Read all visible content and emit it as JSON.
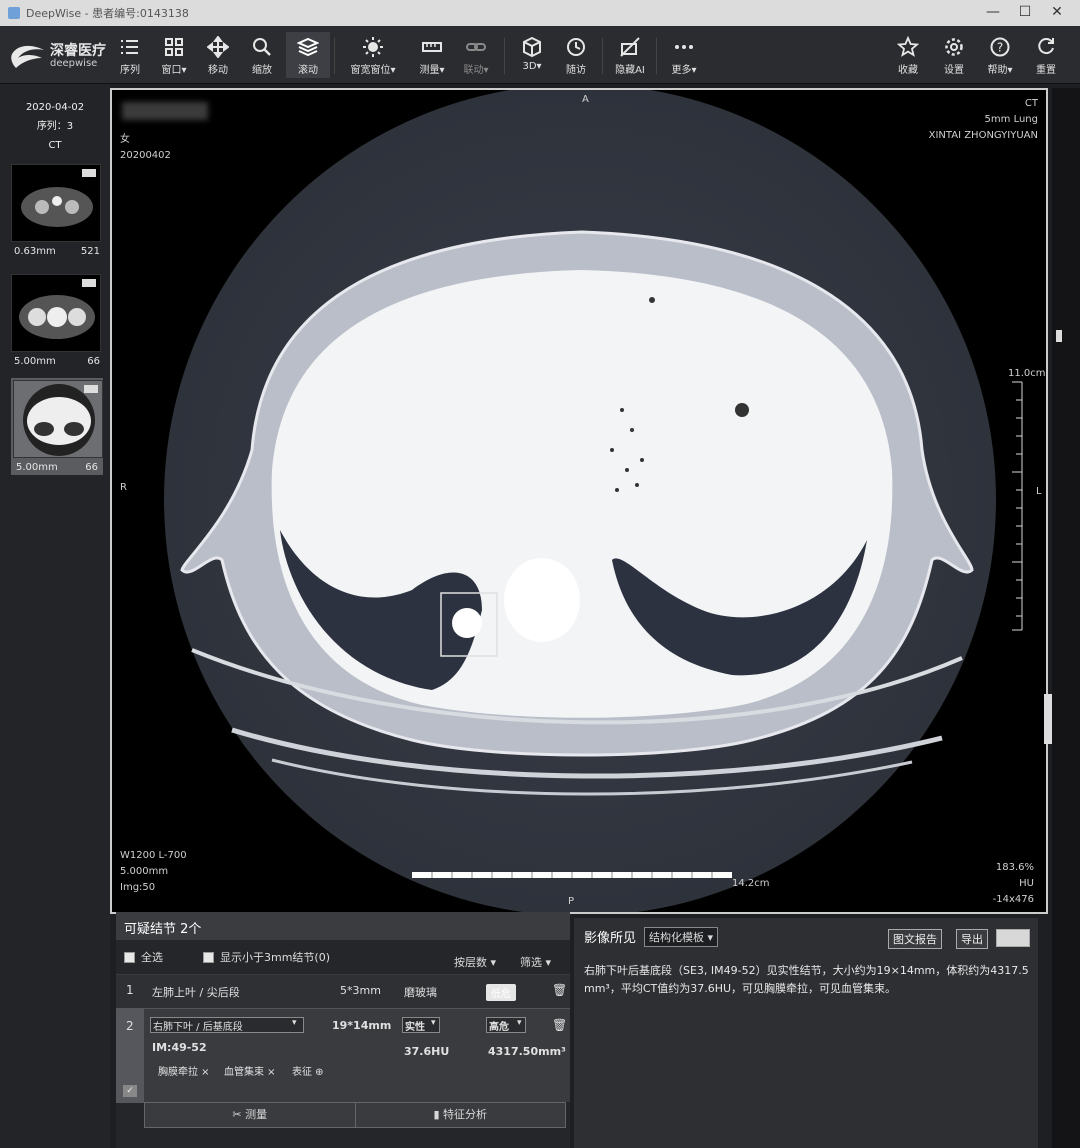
{
  "window": {
    "title": "DeepWise - 患者编号:0143138"
  },
  "logo": {
    "name": "深睿医疗",
    "sub": "deepwise"
  },
  "toolbar": [
    {
      "label": "序列",
      "icon": "list-icon"
    },
    {
      "label": "窗口▾",
      "icon": "grid-icon"
    },
    {
      "label": "移动",
      "icon": "move-icon"
    },
    {
      "label": "缩放",
      "icon": "zoom-icon"
    },
    {
      "label": "滚动",
      "icon": "layers-icon"
    },
    {
      "label": "窗宽窗位▾",
      "icon": "brightness-icon"
    },
    {
      "label": "测量▾",
      "icon": "ruler-icon"
    },
    {
      "label": "联动▾",
      "icon": "link-icon"
    },
    {
      "label": "3D▾",
      "icon": "cube-icon"
    },
    {
      "label": "随访",
      "icon": "clock-icon"
    },
    {
      "label": "隐藏AI",
      "icon": "hide-ai-icon"
    },
    {
      "label": "更多▾",
      "icon": "more-icon"
    },
    {
      "label": "收藏",
      "icon": "star-icon"
    },
    {
      "label": "设置",
      "icon": "gear-icon"
    },
    {
      "label": "帮助▾",
      "icon": "help-icon"
    },
    {
      "label": "重置",
      "icon": "reset-icon"
    }
  ],
  "sidebar": {
    "date": "2020-04-02",
    "series": "序列：3",
    "modality": "CT",
    "thumbs": [
      {
        "thickness": "0.63mm",
        "count": "521"
      },
      {
        "thickness": "5.00mm",
        "count": "66"
      },
      {
        "thickness": "5.00mm",
        "count": "66"
      }
    ]
  },
  "viewer": {
    "top_marker": "A",
    "bottom_marker": "P",
    "left_marker": "R",
    "right_marker": "L",
    "sex": "女",
    "study_date": "20200402",
    "modality": "CT",
    "protocol": "5mm Lung",
    "hospital": "XINTAI ZHONGYIYUAN",
    "window": "W1200 L-700",
    "thickness": "5.000mm",
    "img": "Img:50",
    "zoom": "183.6%",
    "unit": "HU",
    "hu_value": "-14x476",
    "ruler_v": "11.0cm",
    "ruler_h": "14.2cm"
  },
  "nodules": {
    "title": "可疑结节 2个",
    "select_all": "全选",
    "show_small": "显示小于3mm结节(0)",
    "sort": "按层数 ▾",
    "filter": "筛选 ▾",
    "list": [
      {
        "index": "1",
        "location": "左肺上叶 / 尖后段",
        "size": "5*3mm",
        "type": "磨玻璃",
        "risk": "低危"
      },
      {
        "index": "2",
        "location": "右肺下叶 / 后基底段",
        "size": "19*14mm",
        "type": "实性",
        "risk": "高危",
        "im": "IM:49-52",
        "hu": "37.6HU",
        "volume": "4317.50mm³",
        "tags": [
          "胸膜牵拉 ×",
          "血管集束 ×",
          "表征 ⊕"
        ]
      }
    ],
    "measure_btn": "测量",
    "analysis_btn": "特征分析"
  },
  "findings": {
    "title": "影像所见",
    "template": "结构化模板 ▾",
    "report_btn": "图文报告",
    "export_btn": "导出",
    "text": "右肺下叶后基底段（SE3, IM49-52）见实性结节，大小约为19×14mm，体积约为4317.5 mm³，平均CT值约为37.6HU，可见胸膜牵拉，可见血管集束。"
  }
}
